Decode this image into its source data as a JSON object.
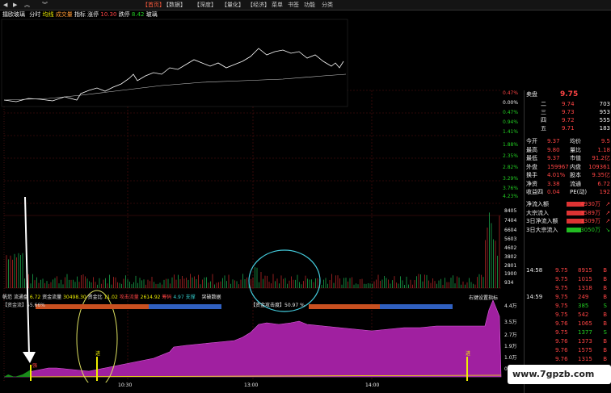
{
  "toolbar": {
    "items": [
      "【首页】",
      "【数据】",
      "【深度】",
      "【量化】",
      "【经济】",
      "菜单",
      "书签",
      "功能",
      "分类"
    ],
    "active_index": 0
  },
  "top_chart": {
    "legend": [
      "擂欧玻璃",
      "分时",
      "均线",
      "成交量",
      "指标",
      "涨停",
      "10.30",
      "跌停",
      "8.42",
      "玻璃"
    ],
    "pct_labels": [
      "0.47%",
      "0.00%",
      "0.47%",
      "0.94%",
      "1.41%",
      "1.88%",
      "2.35%",
      "2.82%",
      "3.29%",
      "3.76%",
      "4.23%"
    ],
    "volume_labels": [
      "8405",
      "7404",
      "6604",
      "5603",
      "4602",
      "3802",
      "2801",
      "1900",
      "934"
    ]
  },
  "indicator": {
    "row1": [
      "帆范",
      "流通盘",
      "6.72",
      "资金流量",
      "30498.30",
      "资金比",
      "11.02",
      "攻击流量",
      "2614.92",
      "筹码",
      "4.97",
      "支撑",
      "突破数据"
    ],
    "row2_left": "【资金流】55.66%",
    "row2_mid": "【资金攻击度】50.97 %",
    "row2_right": "右键设置指标",
    "right_axis": [
      "4.4万",
      "3.5万",
      "2.7万",
      "1.9万",
      "1.0万",
      "0.08万"
    ],
    "marker_labels": [
      "强",
      "进",
      "进"
    ]
  },
  "time_axis": [
    "10:30",
    "13:00",
    "14:00"
  ],
  "quote": {
    "sell_label": "卖盘",
    "sell_price": "9.75",
    "levels": [
      {
        "name": "二",
        "price": "9.74",
        "vol": "703"
      },
      {
        "name": "三",
        "price": "9.73",
        "vol": "953"
      },
      {
        "name": "四",
        "price": "9.72",
        "vol": "555"
      },
      {
        "name": "五",
        "price": "9.71",
        "vol": "183"
      }
    ],
    "stats": [
      [
        "今开",
        "9.37",
        "均价",
        "9.5"
      ],
      [
        "最高",
        "9.80",
        "量比",
        "1.18"
      ],
      [
        "最低",
        "9.37",
        "市值",
        "91.2亿"
      ],
      [
        "外盘",
        "159967",
        "内盘",
        "109361"
      ],
      [
        "换手",
        "4.01%",
        "股本",
        "9.35亿"
      ],
      [
        "净资",
        "3.38",
        "流通",
        "6.72"
      ],
      [
        "收益四",
        "0.04",
        "PE(动)",
        "192"
      ]
    ],
    "flows": [
      {
        "label": "净流入额",
        "value": "4930万",
        "dir": "up"
      },
      {
        "label": "大宗流入",
        "value": "3589万",
        "dir": "up"
      },
      {
        "label": "3日净流入额",
        "value": "1309万",
        "dir": "up"
      },
      {
        "label": "3日大宗流入",
        "value": "-3050万",
        "dir": "down"
      }
    ],
    "ticks": [
      {
        "time": "14:58",
        "price": "9.75",
        "vol": "8915",
        "flag": "B"
      },
      {
        "time": "",
        "price": "9.75",
        "vol": "1015",
        "flag": "B"
      },
      {
        "time": "",
        "price": "9.75",
        "vol": "1318",
        "flag": "B"
      },
      {
        "time": "14:59",
        "price": "9.75",
        "vol": "249",
        "flag": "B"
      },
      {
        "time": "",
        "price": "9.75",
        "vol": "385",
        "flag": "S"
      },
      {
        "time": "",
        "price": "9.75",
        "vol": "542",
        "flag": "B"
      },
      {
        "time": "",
        "price": "9.76",
        "vol": "1065",
        "flag": "B"
      },
      {
        "time": "",
        "price": "9.75",
        "vol": "1377",
        "flag": "S"
      },
      {
        "time": "",
        "price": "9.76",
        "vol": "1373",
        "flag": "B"
      },
      {
        "time": "",
        "price": "9.76",
        "vol": "1575",
        "flag": "B"
      },
      {
        "time": "",
        "price": "9.76",
        "vol": "1315",
        "flag": "B"
      },
      {
        "time": "",
        "price": "9.76",
        "vol": "210",
        "flag": "S"
      }
    ]
  },
  "watermark": "www.7gpzb.com",
  "colors": {
    "up": "#ff3333",
    "down": "#22cc22",
    "magenta": "#a020a0",
    "grid": "#5a1010"
  }
}
